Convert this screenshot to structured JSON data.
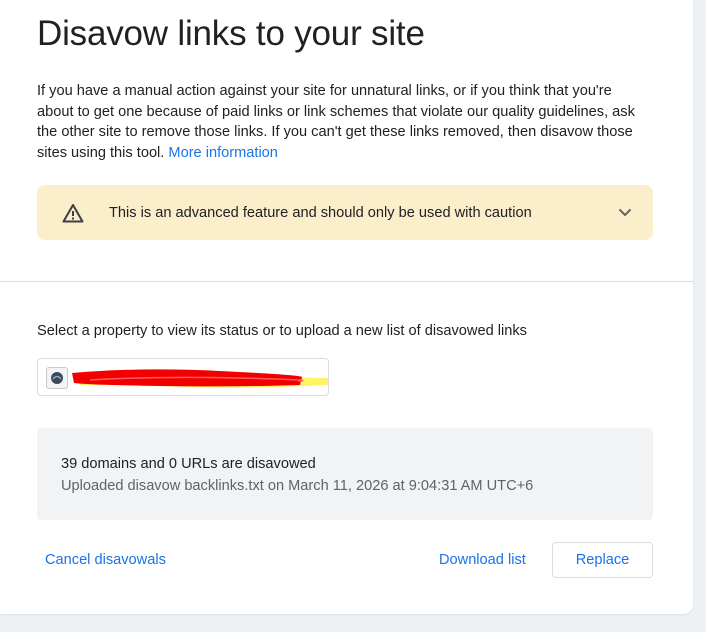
{
  "header": {
    "title": "Disavow links to your site"
  },
  "intro": {
    "text": "If you have a manual action against your site for unnatural links, or if you think that you're about to get one because of paid links or link schemes that violate our quality guidelines, ask the other site to remove those links. If you can't get these links removed, then disavow those sites using this tool.",
    "link_label": "More information"
  },
  "warning": {
    "icon": "warning-triangle-icon",
    "text": "This is an advanced feature and should only be used with caution",
    "chevron_icon": "chevron-down-icon",
    "background_color": "#fbeeca"
  },
  "property": {
    "label": "Select a property to view its status or to upload a new list of disavowed links",
    "selected_value_redacted": true
  },
  "status": {
    "summary": "39 domains and 0 URLs are disavowed",
    "uploaded": "Uploaded disavow backlinks.txt on March 11, 2026 at 9:04:31 AM UTC+6"
  },
  "actions": {
    "cancel_label": "Cancel disavowals",
    "download_label": "Download list",
    "replace_label": "Replace"
  },
  "colors": {
    "accent": "#1a73e8",
    "text": "#202124",
    "muted": "#5f6368"
  }
}
